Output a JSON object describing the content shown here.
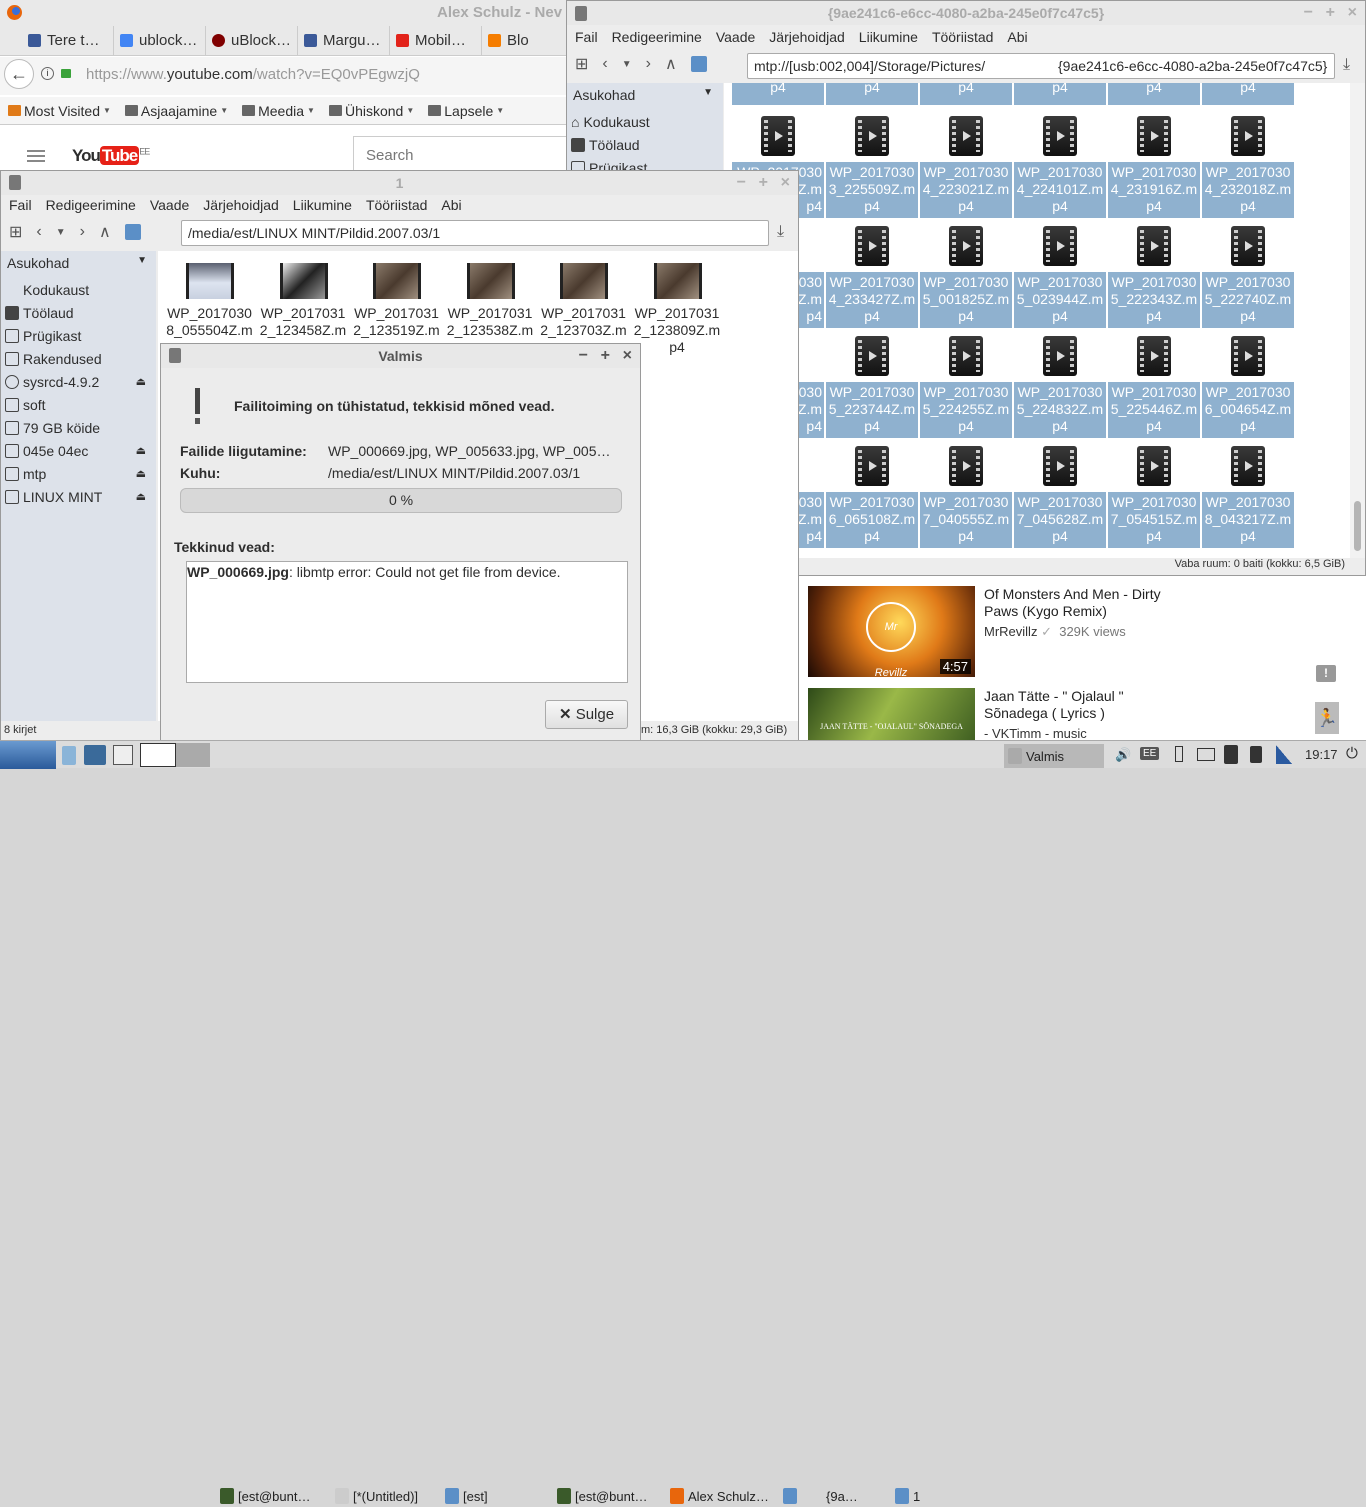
{
  "browser": {
    "title": "Alex Schulz - Nev",
    "tabs": [
      {
        "label": "Tere t…",
        "icon": "facebook-icon"
      },
      {
        "label": "ublock…",
        "icon": "google-icon"
      },
      {
        "label": "uBlock…",
        "icon": "ublock-icon"
      },
      {
        "label": "Margu…",
        "icon": "facebook-icon"
      },
      {
        "label": "Mobil…",
        "icon": "huawei-icon"
      },
      {
        "label": "Blo",
        "icon": "blogger-icon"
      }
    ],
    "url_host_prefix": "https://www.",
    "url_host": "youtube.com",
    "url_path": "/watch?v=EQ0vPEgwzjQ",
    "bookmarks": [
      "Most Visited",
      "Asjaajamine",
      "Meedia",
      "Ühiskond",
      "Lapsele"
    ],
    "yt_logo_you": "You",
    "yt_logo_tube": "Tube",
    "yt_region": "EE",
    "search_placeholder": "Search",
    "videos": [
      {
        "title_l1": "Of Monsters And Men - Dirty",
        "title_l2": "Paws (Kygo Remix)",
        "channel": "MrRevillz",
        "views": "329K views",
        "duration": "4:57",
        "thumb_text": "Mr Revillz"
      },
      {
        "title_l1": "Jaan Tätte - \" Ojalaul \"",
        "title_l2": "Sõnadega ( Lyrics )",
        "channel": "- VKTimm - music",
        "thumb_text": "JAAN TÄTTE - \"OJALAUL\" SÕNADEGA"
      }
    ]
  },
  "menu": [
    "Fail",
    "Redigeerimine",
    "Vaade",
    "Järjehoidjad",
    "Liikumine",
    "Tööriistad",
    "Abi"
  ],
  "right_fm": {
    "title": "{9ae241c6-e6cc-4080-a2ba-245e0f7c47c5}",
    "path": "mtp://[usb:002,004]/Storage/Pictures/",
    "path_suffix": "{9ae241c6-e6cc-4080-a2ba-245e0f7c47c5}",
    "places_header": "Asukohad",
    "places": [
      "Kodukaust",
      "Töölaud",
      "Prügikast"
    ],
    "status": "Vaba ruum: 0 baiti (kokku: 6,5 GiB)",
    "top_row_tail": "p4",
    "rows": [
      [
        [
          "WP_2017030",
          "Z.m",
          "p4"
        ],
        [
          "WP_2017030",
          "3_225509Z.m",
          "p4"
        ],
        [
          "WP_2017030",
          "4_223021Z.m",
          "p4"
        ],
        [
          "WP_2017030",
          "4_224101Z.m",
          "p4"
        ],
        [
          "WP_2017030",
          "4_231916Z.m",
          "p4"
        ],
        [
          "WP_2017030",
          "4_232018Z.m",
          "p4"
        ]
      ],
      [
        [
          "WP_2017030",
          "Z.m",
          "p4"
        ],
        [
          "WP_2017030",
          "4_233427Z.m",
          "p4"
        ],
        [
          "WP_2017030",
          "5_001825Z.m",
          "p4"
        ],
        [
          "WP_2017030",
          "5_023944Z.m",
          "p4"
        ],
        [
          "WP_2017030",
          "5_222343Z.m",
          "p4"
        ],
        [
          "WP_2017030",
          "5_222740Z.m",
          "p4"
        ]
      ],
      [
        [
          "WP_2017030",
          "Z.m",
          "p4"
        ],
        [
          "WP_2017030",
          "5_223744Z.m",
          "p4"
        ],
        [
          "WP_2017030",
          "5_224255Z.m",
          "p4"
        ],
        [
          "WP_2017030",
          "5_224832Z.m",
          "p4"
        ],
        [
          "WP_2017030",
          "5_225446Z.m",
          "p4"
        ],
        [
          "WP_2017030",
          "6_004654Z.m",
          "p4"
        ]
      ],
      [
        [
          "WP_2017030",
          "Z.m",
          "p4"
        ],
        [
          "WP_2017030",
          "6_065108Z.m",
          "p4"
        ],
        [
          "WP_2017030",
          "7_040555Z.m",
          "p4"
        ],
        [
          "WP_2017030",
          "7_045628Z.m",
          "p4"
        ],
        [
          "WP_2017030",
          "7_054515Z.m",
          "p4"
        ],
        [
          "WP_2017030",
          "8_043217Z.m",
          "p4"
        ]
      ]
    ]
  },
  "left_fm": {
    "title": "1",
    "path": "/media/est/LINUX MINT/Pildid.2007.03/1",
    "places_header": "Asukohad",
    "places": [
      {
        "label": "Kodukaust"
      },
      {
        "label": "Töölaud"
      },
      {
        "label": "Prügikast"
      },
      {
        "label": "Rakendused"
      },
      {
        "label": "sysrcd-4.9.2",
        "eject": "⏏"
      },
      {
        "label": "soft"
      },
      {
        "label": "79 GB köide"
      },
      {
        "label": "045e 04ec",
        "eject": "⏏"
      },
      {
        "label": "mtp",
        "eject": "⏏"
      },
      {
        "label": "LINUX MINT",
        "eject": "⏏"
      }
    ],
    "files": [
      [
        "WP_2017030",
        "8_055504Z.m"
      ],
      [
        "WP_2017031",
        "2_123458Z.m"
      ],
      [
        "WP_2017031",
        "2_123519Z.m"
      ],
      [
        "WP_2017031",
        "2_123538Z.m"
      ],
      [
        "WP_2017031",
        "2_123703Z.m"
      ],
      [
        "WP_2017031",
        "2_123809Z.m",
        "p4"
      ]
    ],
    "status_left": "8 kirjet",
    "status_right": "m: 16,3 GiB (kokku: 29,3 GiB)"
  },
  "dialog": {
    "title": "Valmis",
    "heading": "Failitoiming on tühistatud, tekkisid mõned vead.",
    "moving_label": "Failide liigutamine:",
    "moving_value": "WP_000669.jpg, WP_005633.jpg, WP_005…",
    "dest_label": "Kuhu:",
    "dest_value": "/media/est/LINUX MINT/Pildid.2007.03/1",
    "progress_text": "0 %",
    "progress": 0,
    "errors_label": "Tekkinud vead:",
    "error_file": "WP_000669.jpg",
    "error_msg": ": libmtp error:  Could not get file from device.",
    "close_button": "Sulge"
  },
  "taskbar": {
    "items": [
      "[est@bunt…",
      "[*(Untitled)]",
      "[est]",
      "[est@bunt…",
      "Alex Schulz…",
      "",
      "{9a…",
      "1",
      "Valmis"
    ],
    "kbd": "EE",
    "clock": "19:17"
  }
}
